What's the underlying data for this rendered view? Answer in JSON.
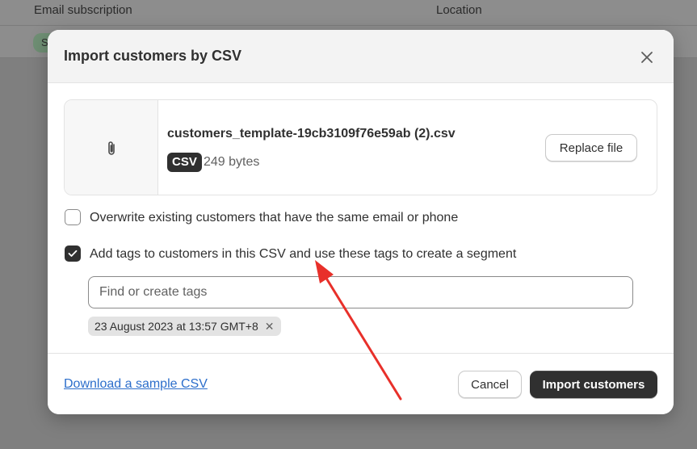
{
  "background": {
    "columns": [
      "Email subscription",
      "Location"
    ],
    "badge_text": "S"
  },
  "modal": {
    "title": "Import customers by CSV",
    "close_icon": "close-icon",
    "file": {
      "icon": "paperclip-icon",
      "name": "customers_template-19cb3109f76e59ab (2).csv",
      "type_badge": "CSV",
      "size": "249 bytes",
      "replace_label": "Replace file"
    },
    "options": [
      {
        "label": "Overwrite existing customers that have the same email or phone",
        "checked": false
      },
      {
        "label": "Add tags to customers in this CSV and use these tags to create a segment",
        "checked": true
      }
    ],
    "tags": {
      "placeholder": "Find or create tags",
      "value": "",
      "chips": [
        "23 August 2023 at 13:57 GMT+8"
      ]
    },
    "footer": {
      "download_link": "Download a sample CSV",
      "cancel_label": "Cancel",
      "import_label": "Import customers"
    }
  },
  "colors": {
    "primary_button": "#303030",
    "link": "#2c6ecb",
    "annotation_arrow": "#e8302a"
  }
}
